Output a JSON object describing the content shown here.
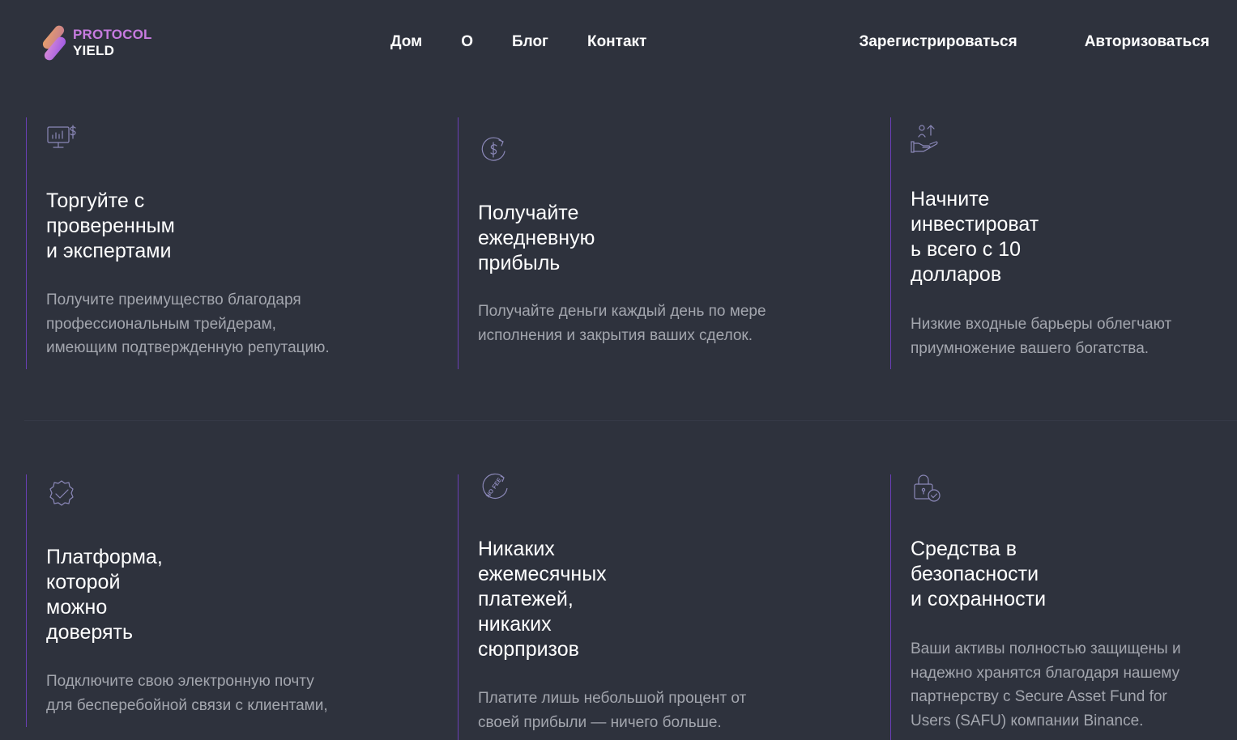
{
  "header": {
    "logo": {
      "line1": "PROTOCOL",
      "line2": "YIELD"
    },
    "nav": [
      "Дом",
      "О",
      "Блог",
      "Контакт"
    ],
    "register_label": "Зарегистрироваться",
    "login_label": "Авторизоваться"
  },
  "features": [
    {
      "icon": "monitor-chart-dollar-icon",
      "title": "Торгуйте с\nпроверенным\nи экспертами",
      "text": "Получите преимущество благодаря\nпрофессиональным трейдерам,\nимеющим подтвержденную репутацию."
    },
    {
      "icon": "dollar-refresh-icon",
      "title": "Получайте\nежедневную\nприбыль",
      "text": "Получайте деньги каждый день по мере\nисполнения и закрытия ваших сделок."
    },
    {
      "icon": "hand-investment-icon",
      "title": "Начните\nинвестироват\nь всего с 10\nдолларов",
      "text": "Низкие входные барьеры облегчают\nприумножение вашего богатства."
    },
    {
      "icon": "verified-badge-icon",
      "title": "Платформа,\nкоторой\nможно\nдоверять",
      "text": "Подключите свою электронную почту\nдля бесперебойной связи с клиентами,"
    },
    {
      "icon": "no-fee-icon",
      "icon_text": "NO FEE",
      "title": "Никаких\nежемесячных\nплатежей,\nникаких\nсюрпризов",
      "text": "Платите лишь небольшой процент от\nсвоей прибыли — ничего больше."
    },
    {
      "icon": "lock-check-icon",
      "title": "Средства в\nбезопасности\nи сохранности",
      "text": "Ваши активы полностью защищены и\nнадежно хранятся благодаря нашему\nпартнерству с Secure Asset Fund for\nUsers (SAFU) компании Binance."
    }
  ],
  "colors": {
    "background": "#2e323d",
    "accent_border": "#6a3fb5",
    "logo_gradient_start": "#e29a63",
    "logo_gradient_end": "#b861e6",
    "muted_text": "#a3a6ae"
  }
}
